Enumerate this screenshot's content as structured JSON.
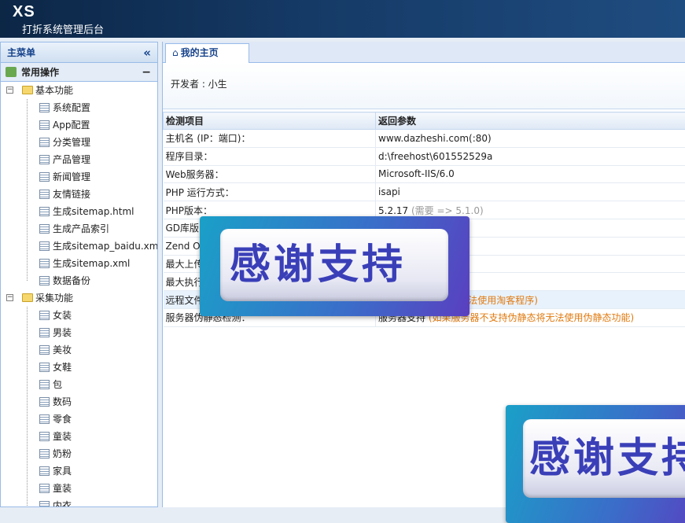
{
  "header": {
    "logo": "XS",
    "subtitle": "打折系统管理后台"
  },
  "sidebar": {
    "title": "主菜单",
    "collapse_glyph": "«",
    "group": {
      "label": "常用操作",
      "toggle": "−"
    },
    "folders": [
      {
        "label": "基本功能",
        "toggle": "−",
        "items": [
          "系统配置",
          "App配置",
          "分类管理",
          "产品管理",
          "新闻管理",
          "友情链接",
          "生成sitemap.html",
          "生成产品索引",
          "生成sitemap_baidu.xml",
          "生成sitemap.xml",
          "数据备份"
        ]
      },
      {
        "label": "采集功能",
        "toggle": "−",
        "items": [
          "女装",
          "男装",
          "美妆",
          "女鞋",
          "包",
          "数码",
          "零食",
          "童装",
          "奶粉",
          "家具",
          "童装",
          "内衣"
        ]
      }
    ]
  },
  "main": {
    "tab": {
      "icon": "home-icon",
      "label": "我的主页"
    },
    "developer": "开发者 : 小生",
    "table": {
      "headers": [
        "检测项目",
        "返回参数"
      ],
      "rows": [
        {
          "item": "主机名 (IP：端口)：",
          "value": "www.dazheshi.com(:80)",
          "extra": ""
        },
        {
          "item": "程序目录：",
          "value": "d:\\freehost\\601552529a",
          "extra": ""
        },
        {
          "item": "Web服务器：",
          "value": "Microsoft-IIS/6.0",
          "extra": ""
        },
        {
          "item": "PHP 运行方式：",
          "value": "isapi",
          "extra": ""
        },
        {
          "item": "PHP版本：",
          "value": "5.2.17",
          "extra": "(需要 => 5.1.0)"
        },
        {
          "item": "GD库版",
          "value": "",
          "extra": "atible)"
        },
        {
          "item": "Zend Op",
          "value": "",
          "extra": ""
        },
        {
          "item": "最大上传",
          "value": "",
          "extra": ""
        },
        {
          "item": "最大执行",
          "value": "",
          "extra": ""
        },
        {
          "item": "远程文件",
          "value": "",
          "extra": "器不支持TOPAPI将无法使用淘客程序)"
        },
        {
          "item": "服务器伪静态检测：",
          "value": "服务器支持",
          "extra": "(如果服务器不支持伪静态将无法使用伪静态功能)"
        }
      ]
    }
  },
  "overlays": {
    "banner_text": "感谢支持"
  },
  "colors": {
    "header_bg": "#153a66",
    "accent": "#15428b",
    "note": "#e07a10",
    "banner": "#3b6cc9"
  }
}
